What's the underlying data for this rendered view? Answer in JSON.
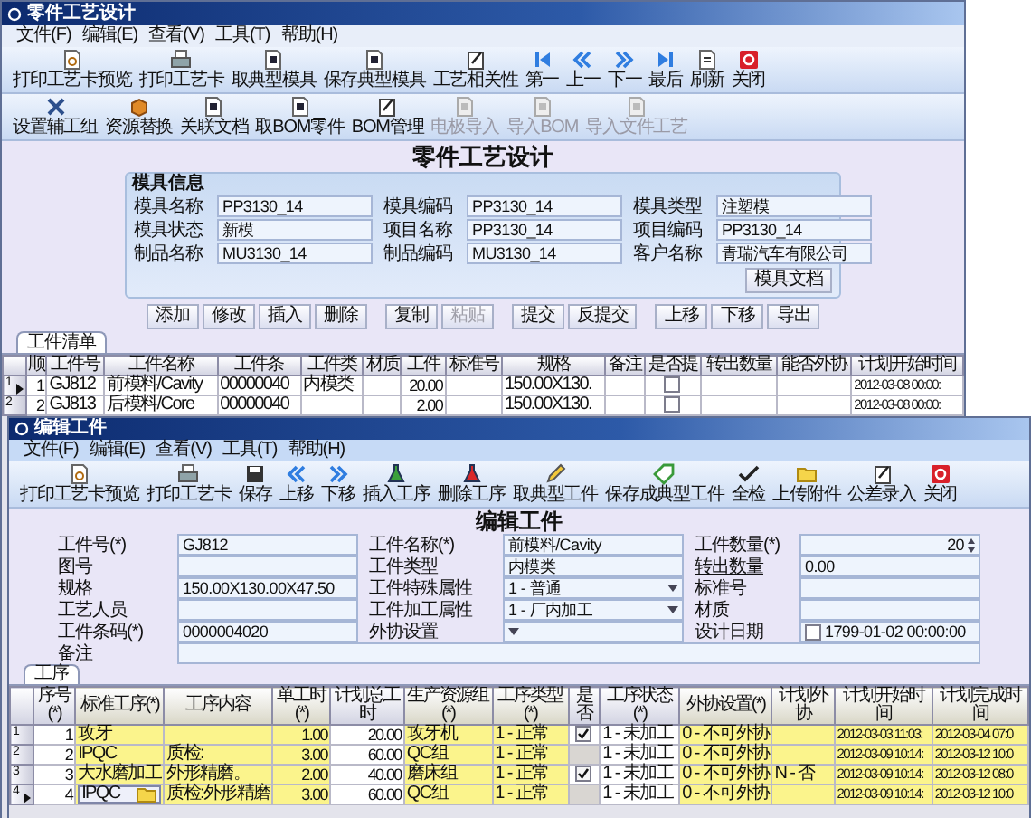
{
  "main_window": {
    "title": "零件工艺设计",
    "menu": [
      "文件(F)",
      "编辑(E)",
      "查看(V)",
      "工具(T)",
      "帮助(H)"
    ],
    "toolbars": [
      [
        {
          "label": "打印工艺卡预览",
          "disabled": false
        },
        {
          "label": "打印工艺卡",
          "disabled": false
        },
        {
          "label": "取典型模具",
          "disabled": false
        },
        {
          "label": "保存典型模具",
          "disabled": false
        },
        {
          "label": "工艺相关性",
          "disabled": false
        },
        {
          "label": "第一",
          "disabled": false
        },
        {
          "label": "上一",
          "disabled": false
        },
        {
          "label": "下一",
          "disabled": false
        },
        {
          "label": "最后",
          "disabled": false
        },
        {
          "label": "刷新",
          "disabled": false
        },
        {
          "label": "关闭",
          "disabled": false
        }
      ],
      [
        {
          "label": "设置辅工组",
          "disabled": false
        },
        {
          "label": "资源替换",
          "disabled": false
        },
        {
          "label": "关联文档",
          "disabled": false
        },
        {
          "label": "取BOM零件",
          "disabled": false
        },
        {
          "label": "BOM管理",
          "disabled": false
        },
        {
          "label": "电极导入",
          "disabled": true
        },
        {
          "label": "导入BOM",
          "disabled": true
        },
        {
          "label": "导入文件工艺",
          "disabled": true
        }
      ]
    ],
    "heading": "零件工艺设计",
    "mold_info": {
      "title": "模具信息",
      "fields": [
        {
          "label": "模具名称",
          "value": "PP3130_14"
        },
        {
          "label": "模具编码",
          "value": "PP3130_14"
        },
        {
          "label": "模具类型",
          "value": "注塑模"
        },
        {
          "label": "模具状态",
          "value": "新模"
        },
        {
          "label": "项目名称",
          "value": "PP3130_14"
        },
        {
          "label": "项目编码",
          "value": "PP3130_14"
        },
        {
          "label": "制品名称",
          "value": "MU3130_14"
        },
        {
          "label": "制品编码",
          "value": "MU3130_14"
        },
        {
          "label": "客户名称",
          "value": "青瑞汽车有限公司"
        }
      ],
      "document_button": "模具文档"
    },
    "actions": [
      [
        {
          "label": "添加",
          "disabled": false
        },
        {
          "label": "修改",
          "disabled": false
        },
        {
          "label": "插入",
          "disabled": false
        },
        {
          "label": "删除",
          "disabled": false
        }
      ],
      [
        {
          "label": "复制",
          "disabled": false
        },
        {
          "label": "粘贴",
          "disabled": true
        }
      ],
      [
        {
          "label": "提交",
          "disabled": false
        },
        {
          "label": "反提交",
          "disabled": false
        }
      ],
      [
        {
          "label": "上移",
          "disabled": false
        },
        {
          "label": "下移",
          "disabled": false
        },
        {
          "label": "导出",
          "disabled": false
        }
      ]
    ],
    "tabs": [
      {
        "label": "工件清单",
        "selected": true
      }
    ],
    "table": {
      "columns": [
        {
          "label": "顺",
          "kind": "number"
        },
        {
          "label": "工件号",
          "kind": "text"
        },
        {
          "label": "工件名称",
          "kind": "text"
        },
        {
          "label": "工件条",
          "kind": "text"
        },
        {
          "label": "工件类",
          "kind": "text"
        },
        {
          "label": "材质",
          "kind": "text"
        },
        {
          "label": "工件",
          "kind": "number"
        },
        {
          "label": "标准号",
          "kind": "text"
        },
        {
          "label": "规格",
          "kind": "text"
        },
        {
          "label": "备注",
          "kind": "text"
        },
        {
          "label": "是否提",
          "kind": "check"
        },
        {
          "label": "转出数量",
          "kind": "text"
        },
        {
          "label": "能否外协",
          "kind": "text"
        },
        {
          "label": "计划开始时间",
          "kind": "date"
        }
      ],
      "rows": [
        {
          "number": "1",
          "selected": true,
          "cells": [
            "1",
            "GJ812",
            "前模料/Cavity",
            "00000040",
            "内模类",
            "",
            "20.00",
            "",
            "150.00X130.",
            "",
            {
              "checked": false,
              "disabled": false
            },
            "",
            "",
            "2012-03-08 00:00:"
          ]
        },
        {
          "number": "2",
          "selected": false,
          "cells": [
            "2",
            "GJ813",
            "后模料/Core",
            "00000040",
            "",
            "",
            "2.00",
            "",
            "150.00X130.",
            "",
            {
              "checked": false,
              "disabled": false
            },
            "",
            "",
            "2012-03-08 00:00:"
          ]
        }
      ]
    }
  },
  "edit_window": {
    "title": "编辑工件",
    "menu": [
      "文件(F)",
      "编辑(E)",
      "查看(V)",
      "工具(T)",
      "帮助(H)"
    ],
    "toolbar": [
      {
        "label": "打印工艺卡预览",
        "disabled": false
      },
      {
        "label": "打印工艺卡",
        "disabled": false
      },
      {
        "label": "保存",
        "disabled": false
      },
      {
        "label": "上移",
        "disabled": false
      },
      {
        "label": "下移",
        "disabled": false
      },
      {
        "label": "插入工序",
        "disabled": false
      },
      {
        "label": "删除工序",
        "disabled": false
      },
      {
        "label": "取典型工件",
        "disabled": false
      },
      {
        "label": "保存成典型工件",
        "disabled": false
      },
      {
        "label": "全检",
        "disabled": false
      },
      {
        "label": "上传附件",
        "disabled": false
      },
      {
        "label": "公差录入",
        "disabled": false
      },
      {
        "label": "关闭",
        "disabled": false
      }
    ],
    "heading": "编辑工件",
    "form": [
      {
        "label": "工件号(*)",
        "value": "GJ812",
        "kind": "text"
      },
      {
        "label": "工件名称(*)",
        "value": "前模料/Cavity",
        "kind": "text"
      },
      {
        "label": "工件数量(*)",
        "value": "20",
        "kind": "spin"
      },
      {
        "label": "图号",
        "kind": "text"
      },
      {
        "label": "工件类型",
        "value": "内模类",
        "kind": "text"
      },
      {
        "label": "转出数量",
        "value": "0.00",
        "kind": "linked"
      },
      {
        "label": "规格",
        "value": "150.00X130.00X47.50",
        "kind": "text"
      },
      {
        "label": "工件特殊属性",
        "value": "1 - 普通",
        "kind": "select"
      },
      {
        "label": "标准号",
        "kind": "text"
      },
      {
        "label": "工艺人员",
        "kind": "text"
      },
      {
        "label": "工件加工属性",
        "value": "1 - 厂内加工",
        "kind": "select"
      },
      {
        "label": "材质",
        "kind": "text"
      },
      {
        "label": "工件条码(*)",
        "value": "0000004020",
        "kind": "text"
      },
      {
        "label": "外协设置",
        "kind": "select"
      },
      {
        "label": "设计日期",
        "value": "1799-01-02 00:00:00",
        "kind": "date",
        "checked": false
      },
      {
        "label": "备注",
        "kind": "memo"
      }
    ],
    "tabs": [
      {
        "label": "工序",
        "selected": true
      }
    ],
    "table": {
      "columns": [
        {
          "label": "序号(*)",
          "kind": "number",
          "highlighted": false
        },
        {
          "label": "标准工序(*)",
          "kind": "lookup",
          "highlighted": true
        },
        {
          "label": "工序内容",
          "kind": "text",
          "highlighted": true
        },
        {
          "label": "单工时(*)",
          "kind": "number",
          "highlighted": true
        },
        {
          "label": "计划总工时",
          "kind": "number",
          "highlighted": false
        },
        {
          "label": "生产资源组(*)",
          "kind": "text",
          "highlighted": true
        },
        {
          "label": "工序类型(*)",
          "kind": "text",
          "highlighted": true
        },
        {
          "label": "是否",
          "kind": "check",
          "highlighted": false
        },
        {
          "label": "工序状态(*)",
          "kind": "text",
          "highlighted": false
        },
        {
          "label": "外协设置(*)",
          "kind": "text",
          "highlighted": true
        },
        {
          "label": "计划外协",
          "kind": "text",
          "highlighted": true
        },
        {
          "label": "计划开始时间",
          "kind": "date",
          "highlighted": true
        },
        {
          "label": "计划完成时间",
          "kind": "date",
          "highlighted": true
        }
      ],
      "rows": [
        {
          "number": "1",
          "selected": false,
          "cells": [
            "1",
            "攻牙",
            "",
            "1.00",
            "20.00",
            "攻牙机",
            "1 - 正常",
            {
              "checked": true,
              "disabled": false
            },
            "1 - 未加工",
            "0 - 不可外协",
            "",
            "2012-03-03 11:03:",
            "2012-03-04 07:0"
          ]
        },
        {
          "number": "2",
          "selected": false,
          "cells": [
            "2",
            "IPQC",
            "质检:",
            "3.00",
            "60.00",
            "QC组",
            "1 - 正常",
            {
              "disabled": true
            },
            "1 - 未加工",
            "0 - 不可外协",
            "",
            "2012-03-09 10:14:",
            "2012-03-12 10:0"
          ]
        },
        {
          "number": "3",
          "selected": false,
          "cells": [
            "3",
            "大水磨加工",
            "外形精磨。",
            "2.00",
            "40.00",
            "磨床组",
            "1 - 正常",
            {
              "checked": true,
              "disabled": false
            },
            "1 - 未加工",
            "0 - 不可外协",
            "N - 否",
            "2012-03-09 10:14:",
            "2012-03-12 08:0"
          ]
        },
        {
          "number": "4",
          "selected": true,
          "cells": [
            "4",
            "IPQC",
            "质检:外形精磨",
            "3.00",
            "60.00",
            "QC组",
            "1 - 正常",
            {
              "disabled": true
            },
            "1 - 未加工",
            "0 - 不可外协",
            "",
            "2012-03-09 10:14:",
            "2012-03-12 10:0"
          ]
        }
      ]
    }
  }
}
